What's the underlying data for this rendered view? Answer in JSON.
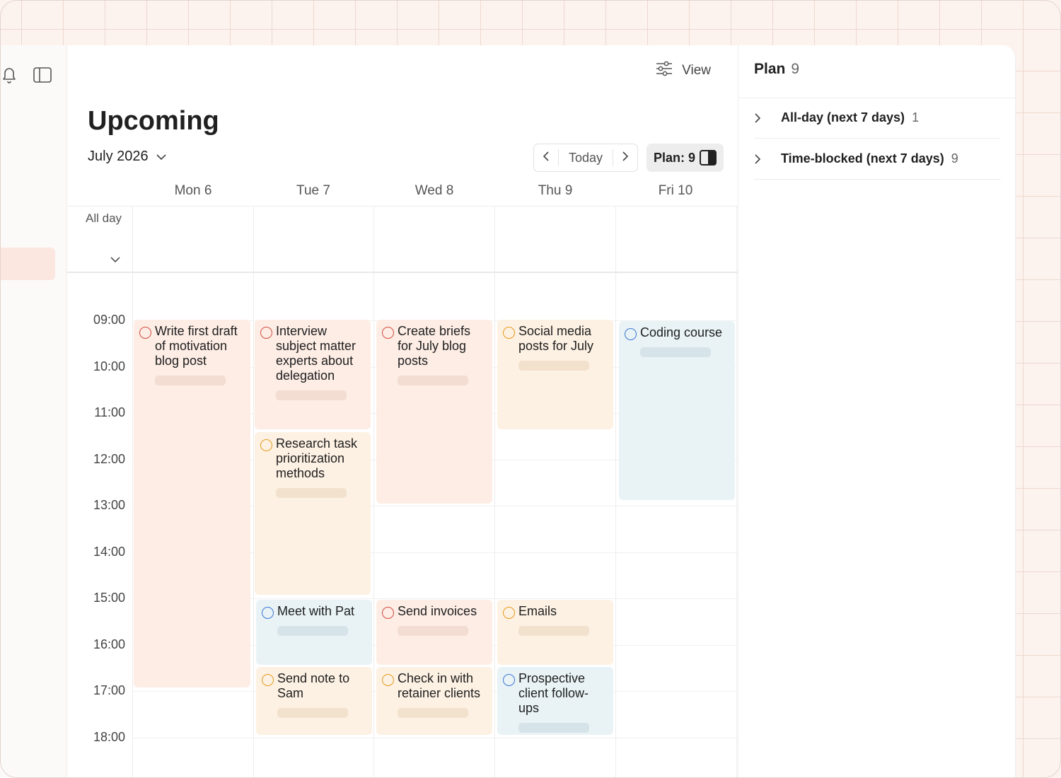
{
  "header": {
    "view_label": "View",
    "title": "Upcoming",
    "month": "July 2026",
    "today_label": "Today",
    "plan_button_label": "Plan: 9"
  },
  "calendar": {
    "days": [
      "Mon 6",
      "Tue 7",
      "Wed 8",
      "Thu 9",
      "Fri 10"
    ],
    "allday_label": "All day",
    "hours": [
      "09:00",
      "10:00",
      "11:00",
      "12:00",
      "13:00",
      "14:00",
      "15:00",
      "16:00",
      "17:00",
      "18:00"
    ],
    "events": [
      {
        "day": 0,
        "title": "Write first draft of motivation blog post",
        "priority": "red"
      },
      {
        "day": 1,
        "title": "Interview subject matter experts about delegation",
        "priority": "red"
      },
      {
        "day": 1,
        "title": "Research task prioritization methods",
        "priority": "orange"
      },
      {
        "day": 1,
        "title": "Meet with Pat",
        "priority": "blue"
      },
      {
        "day": 1,
        "title": "Send note to Sam",
        "priority": "orange"
      },
      {
        "day": 2,
        "title": "Create briefs for July blog posts",
        "priority": "red"
      },
      {
        "day": 2,
        "title": "Send invoices",
        "priority": "red"
      },
      {
        "day": 2,
        "title": "Check in with retainer clients",
        "priority": "orange"
      },
      {
        "day": 3,
        "title": "Social media posts for July",
        "priority": "orange"
      },
      {
        "day": 3,
        "title": "Emails",
        "priority": "orange"
      },
      {
        "day": 3,
        "title": "Prospective client follow-ups",
        "priority": "blue"
      },
      {
        "day": 4,
        "title": "Coding course",
        "priority": "blue"
      }
    ]
  },
  "plan_panel": {
    "title": "Plan",
    "count": "9",
    "sections": [
      {
        "label": "All-day (next 7 days)",
        "count": "1"
      },
      {
        "label": "Time-blocked (next 7 days)",
        "count": "9"
      }
    ]
  },
  "colors": {
    "priority_red": "#d34b3f",
    "priority_orange": "#e59b1c",
    "priority_blue": "#3b76d3",
    "event_red_bg": "#fdede5",
    "event_orange_bg": "#fdf1e3",
    "event_blue_bg": "#e9f3f6"
  },
  "icons": [
    "bell-icon",
    "sidebar-toggle-icon",
    "view-settings-icon",
    "chevron-down-icon",
    "chevron-left-icon",
    "chevron-right-icon",
    "split-view-icon"
  ]
}
